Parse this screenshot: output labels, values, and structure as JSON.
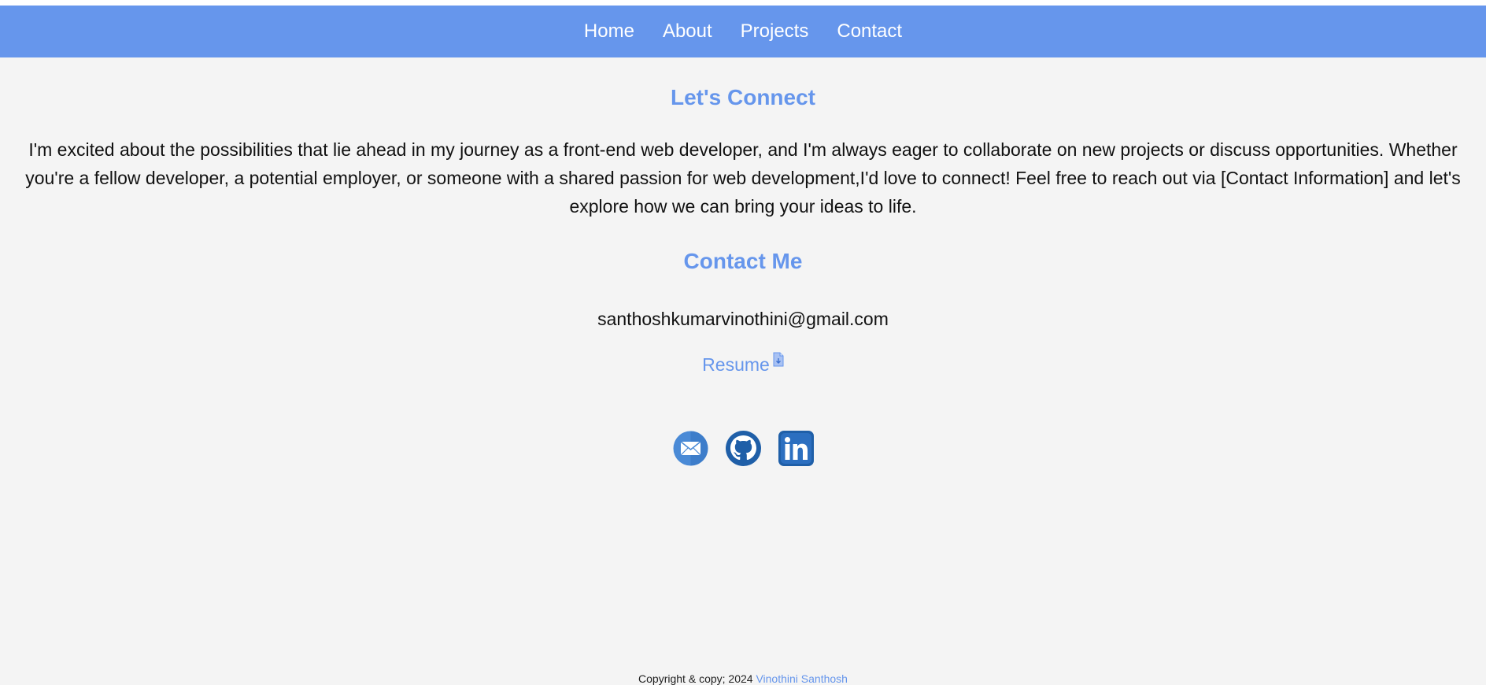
{
  "nav": {
    "items": [
      {
        "label": "Home"
      },
      {
        "label": "About"
      },
      {
        "label": "Projects"
      },
      {
        "label": "Contact"
      }
    ]
  },
  "connect": {
    "title": "Let's Connect",
    "paragraph": "I'm excited about the possibilities that lie ahead in my journey as a front-end web developer, and I'm always eager to collaborate on new projects or discuss opportunities. Whether you're a fellow developer, a potential employer, or someone with a shared passion for web development,I'd love to connect! Feel free to reach out via [Contact Information] and let's explore how we can bring your ideas to life."
  },
  "contact": {
    "title": "Contact Me",
    "email": "santhoshkumarvinothini@gmail.com",
    "resume_label": "Resume",
    "resume_icon": "file-download-icon"
  },
  "socials": {
    "icons": [
      "mail-icon",
      "github-icon",
      "linkedin-icon"
    ]
  },
  "footer": {
    "copyright": "Copyright & copy; 2024",
    "author": "Vinothini Santhosh"
  },
  "colors": {
    "accent": "#6696ec",
    "background": "#f4f4f4"
  }
}
